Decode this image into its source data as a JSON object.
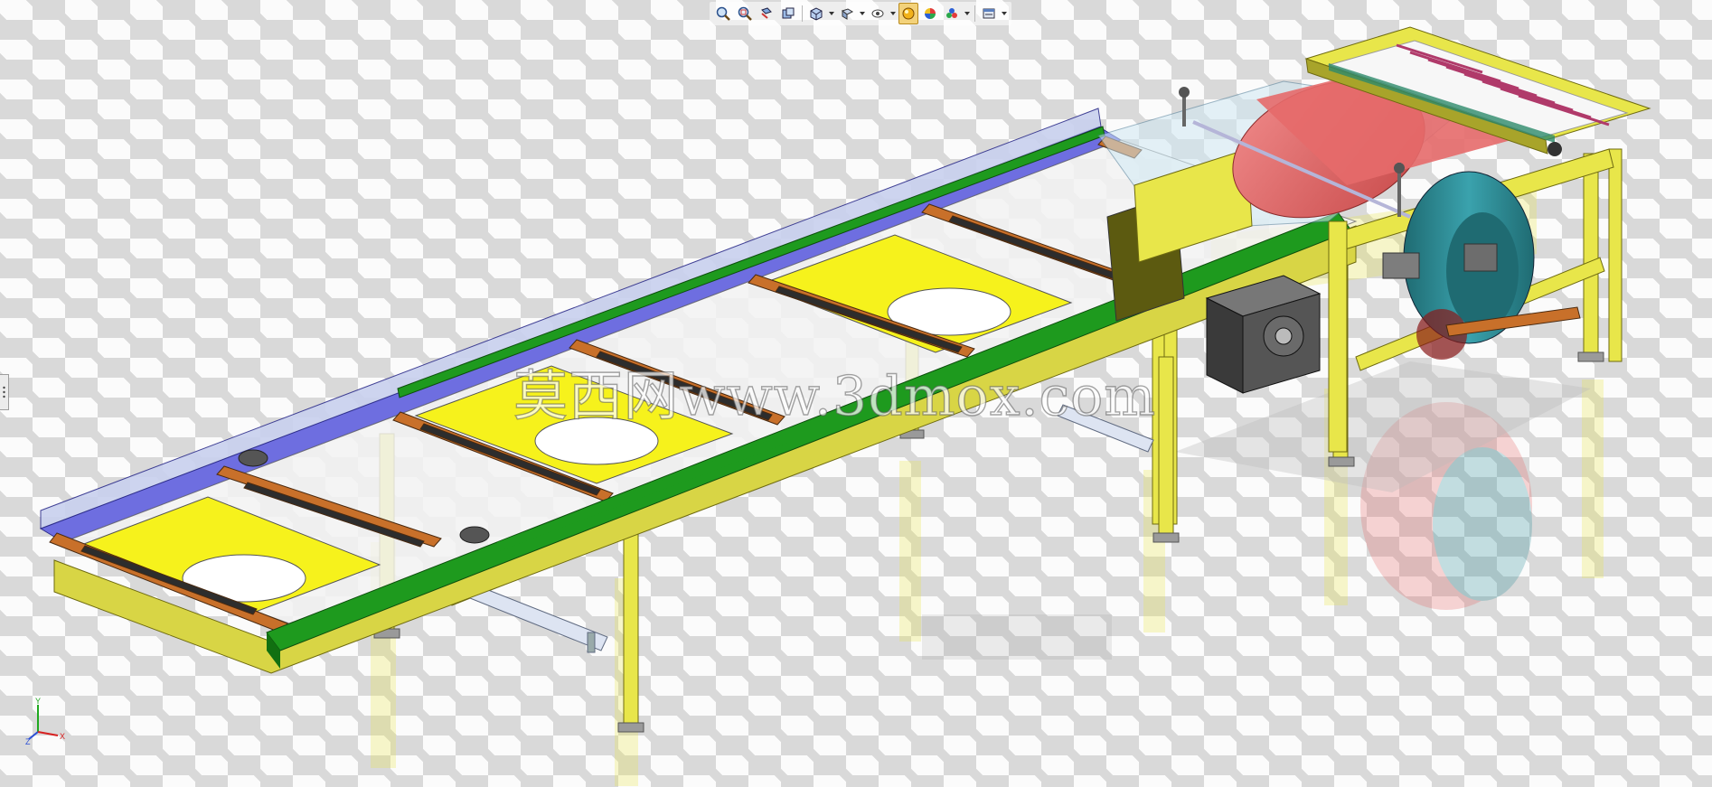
{
  "viewport": {
    "mode": "3D isometric assembly view",
    "background": "checkerboard floor with reflections"
  },
  "hud_toolbar": {
    "buttons": [
      {
        "icon": "zoom-to-fit-icon",
        "has_menu": false
      },
      {
        "icon": "zoom-to-area-icon",
        "has_menu": false
      },
      {
        "icon": "previous-view-icon",
        "has_menu": false
      },
      {
        "icon": "section-view-icon",
        "has_menu": false
      },
      {
        "icon": "view-orientation-icon",
        "has_menu": true
      },
      {
        "icon": "display-style-icon",
        "has_menu": true
      },
      {
        "icon": "hide-show-items-icon",
        "has_menu": true
      },
      {
        "icon": "edit-appearance-icon",
        "has_menu": false,
        "active": true
      },
      {
        "icon": "apply-scene-icon",
        "has_menu": true
      },
      {
        "icon": "view-settings-icon",
        "has_menu": true
      }
    ]
  },
  "watermark": {
    "text": "莫西网www.3dmox.com"
  },
  "triad": {
    "axes": [
      "Y",
      "Z",
      "X"
    ],
    "colors": {
      "x": "#d62020",
      "y": "#1fa81f",
      "z": "#2b4fd6"
    }
  },
  "colors": {
    "frame_yellow": "#e8e64a",
    "frame_olive": "#a8a42a",
    "rail_green": "#1e9a1e",
    "rail_blue": "#6e6ee0",
    "plate_yellow": "#f6f21c",
    "bar_orange": "#c8702a",
    "drum_red": "#e56a6a",
    "wheel_teal": "#2f8f9a",
    "gearbox_gray": "#555555"
  }
}
